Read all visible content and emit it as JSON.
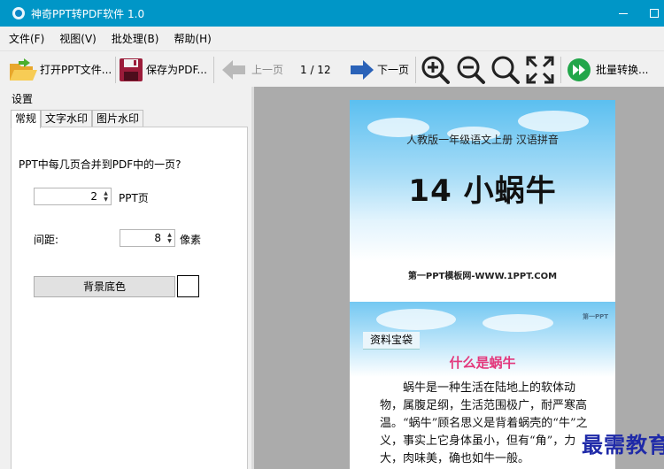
{
  "window": {
    "title": "神奇PPT转PDF软件 1.0"
  },
  "menu": [
    "文件(F)",
    "视图(V)",
    "批处理(B)",
    "帮助(H)"
  ],
  "toolbar": {
    "open": "打开PPT文件...",
    "save": "保存为PDF...",
    "prev": "上一页",
    "page_indicator": "1 / 12",
    "next": "下一页",
    "batch": "批量转换..."
  },
  "settings": {
    "title": "设置",
    "tabs": [
      "常规",
      "文字水印",
      "图片水印"
    ],
    "pages_question": "PPT中每几页合并到PDF中的一页?",
    "pages_value": "2",
    "pages_unit": "PPT页",
    "spacing_label": "间距:",
    "spacing_value": "8",
    "spacing_unit": "像素",
    "bg_color_button": "背景底色",
    "bg_color": "#ffffff"
  },
  "preview": {
    "slide1": {
      "subtitle": "人教版一年级语文上册  汉语拼音",
      "title": "14 小蜗牛",
      "site": "第一PPT模板网-WWW.1PPT.COM"
    },
    "slide2": {
      "tag": "资料宝袋",
      "corner": "第一PPT",
      "heading": "什么是蜗牛",
      "body": "蜗牛是一种生活在陆地上的软体动物，属腹足纲，生活范围极广，耐严寒高温。“蜗牛”顾名思义是背着蜗壳的“牛”之义，事实上它身体虽小，但有“角”，力大，肉味美，确也如牛一般。"
    }
  },
  "overlay_watermark": "最需教育",
  "colors": {
    "titlebar": "#0096c7",
    "accent_pink": "#e3387c",
    "watermark": "#1f2aa8"
  }
}
